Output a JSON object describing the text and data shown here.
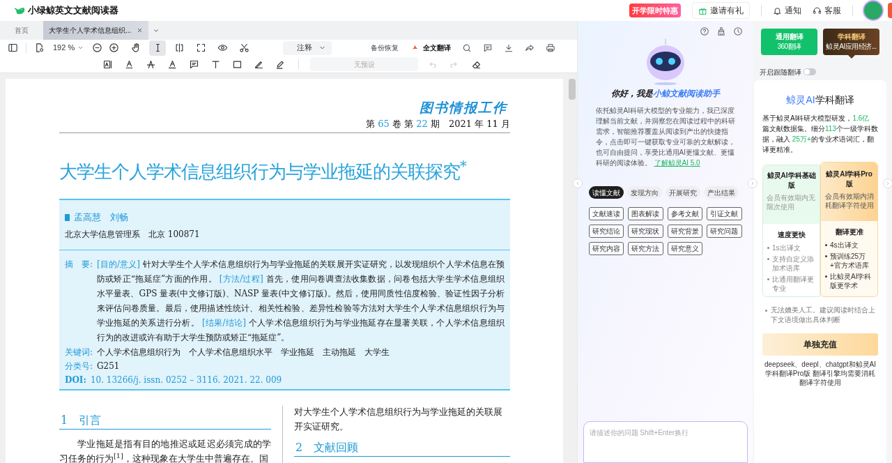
{
  "app": {
    "title": "小绿鲸英文文献阅读器"
  },
  "header": {
    "promo": "开学限时特惠",
    "invite": "邀请有礼",
    "notify": "通知",
    "service": "客服"
  },
  "tabs": [
    {
      "label": "首页",
      "selected": false
    },
    {
      "label": "大学生个人学术信息组织...",
      "selected": true
    }
  ],
  "toolbar": {
    "zoom": "192 %",
    "tools": [
      {
        "selected": false
      },
      {
        "selected": true
      },
      {
        "selected": false
      },
      {
        "selected": false
      },
      {
        "selected": false
      },
      {
        "selected": false
      }
    ],
    "annotation": "注释",
    "backup": "备份恢复",
    "translate": "全文翻译",
    "preset_placeholder": "无预设"
  },
  "document": {
    "journal": "图书情报工作",
    "issue": [
      {
        "text": "第 ",
        "highlight": false
      },
      {
        "text": "65",
        "highlight": true
      },
      {
        "text": " 卷 第 ",
        "highlight": false
      },
      {
        "text": "22",
        "highlight": true
      },
      {
        "text": " 期　2021 年 11 月",
        "highlight": false
      }
    ],
    "title": "大学生个人学术信息组织行为与学业拖延的关联探究$^{*}$",
    "authors": "孟高慧　刘畅",
    "affiliation": "北京大学信息管理系　北京 100871",
    "abstract_label": "摘　要:",
    "abstract": [
      {
        "text": "[目的/意义] ",
        "highlight": true
      },
      {
        "text": "针对大学生个人学术信息组织行为与学业拖延的关联展开实证研究，以发现组织个人学术信息在预防或矫正“拖延症”方面的作用。",
        "highlight": false
      },
      {
        "text": " [方法/过程] ",
        "highlight": true
      },
      {
        "text": "首先，使用问卷调查法收集数据，问卷包括大学生学术信息组织水平量表、GPS 量表(中文修订版)、NASP 量表(中文修订版)。然后，使用同质性信度检验、验证性因子分析来评估问卷质量。最后，使用描述性统计、相关性检验、差异性检验等方法对大学生个人学术信息组织行为与学业拖延的关系进行分析。",
        "highlight": false
      },
      {
        "text": " [结果/结论] ",
        "highlight": true
      },
      {
        "text": "个人学术信息组织行为与学业拖延存在显著关联，个人学术信息组织行为的改进或许有助于大学生预防或矫正“拖延症”。",
        "highlight": false
      }
    ],
    "keywords_label": "关键词:",
    "keywords": "个人学术信息组织行为　个人学术信息组织水平　学业拖延　主动拖延　大学生",
    "class_label": "分类号:",
    "class_number": "G251",
    "doi_label": "DOI:",
    "doi": "10. 13266/j. issn. 0252 – 3116. 2021. 22. 009",
    "left_heading": "1　引言",
    "left_paragraph": "学业拖延是指有目的地推迟或延迟必须完成的学习任务的行为$^{[1]}$，这种现象在大学生中普遍存在。国",
    "right_paragraph": "对大学生个人学术信息组织行为与学业拖延的关联展开实证研究。",
    "right_heading": "2　文献回顾"
  },
  "assistant": {
    "greeting": "你好，我是",
    "name": "小鲸文献阅读助手",
    "intro": "依托鲸灵AI科研大模型的专业能力，我已深度理解当前文献，并洞察您在阅读过程中的科研需求，智能推荐覆盖从阅读到产出的快捷指令，点击即可一键获取专业可靠的文献解读，也可自由提问，享受比通用AI更懂文献、更懂科研的阅读体验。",
    "link": "了解鲸灵AI 5.0",
    "categories": [
      {
        "label": "读懂文献",
        "selected": true
      },
      {
        "label": "发现方向",
        "selected": false
      },
      {
        "label": "开展研究",
        "selected": false
      },
      {
        "label": "产出结果",
        "selected": false
      }
    ],
    "chips": [
      "文献速读",
      "图表解读",
      "参考文献",
      "引证文献",
      "研究结论",
      "研究现状",
      "研究背景",
      "研究问题",
      "研究内容",
      "研究方法",
      "研究意义"
    ],
    "input_placeholder": "请描述你的问题 Shift+Enter换行"
  },
  "translate": {
    "engines": [
      {
        "title": "通用翻译",
        "subtitle": "360翻译",
        "selected": false
      },
      {
        "title": "学科翻译",
        "subtitle": "鲸灵AI应用经济...",
        "selected": true
      }
    ],
    "follow": {
      "label": "开启跟随翻译",
      "on": false
    },
    "brand": "鲸灵AI",
    "heading": "学科翻译",
    "description": [
      {
        "text": "基于鲸灵AI科研大模型研发，",
        "highlight": false
      },
      {
        "text": "1.6亿",
        "highlight": true
      },
      {
        "text": " 篇文献数据集。细分",
        "highlight": false
      },
      {
        "text": "113",
        "highlight": true
      },
      {
        "text": "个一级学科数据，融入 ",
        "highlight": false
      },
      {
        "text": "25万+",
        "highlight": true
      },
      {
        "text": "的专业术语词汇，翻译更精准。",
        "highlight": false
      }
    ],
    "plans": [
      {
        "kind": "basic",
        "name": "鲸灵AI学科基础版",
        "note": "会员有效期内无限次使用",
        "feature_title": "速度更快",
        "features": [
          "1s出译文",
          "支持自定义添加术语库",
          "比通用翻译更专业"
        ]
      },
      {
        "kind": "pro",
        "name": "鲸灵AI学科Pro版",
        "note": "会员有效期内消耗翻译字符使用",
        "feature_title": "翻译更准",
        "features": [
          "4s出译文",
          "预训练25万+官方术语库",
          "比鲸灵AI学科版更学术"
        ]
      }
    ],
    "disclaimer": "无法媲美人工。建议阅读时结合上下文语境做出具体判断",
    "recharge": "单独充值",
    "footnote": "deepseek、deepl、chatgpt和鲸灵AI学科翻译Pro版 翻译引擎均需要消耗翻译字符使用"
  }
}
